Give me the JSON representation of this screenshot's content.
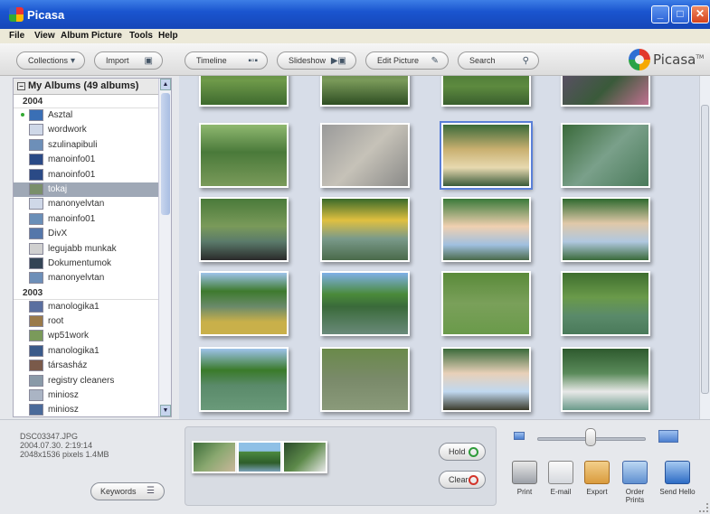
{
  "window": {
    "title": "Picasa"
  },
  "menu": [
    "File",
    "View",
    "Album",
    "Picture",
    "Tools",
    "Help"
  ],
  "toolbar": {
    "collections": "Collections",
    "import": "Import",
    "timeline": "Timeline",
    "slideshow": "Slideshow",
    "edit_picture": "Edit Picture",
    "search": "Search",
    "brand": "Picasa",
    "brand_suffix": "TM"
  },
  "albums": {
    "header": "My Albums (49 albums)",
    "groups": [
      {
        "year": "2004",
        "items": [
          "Asztal",
          "wordwork",
          "szulinapibuli",
          "manoinfo01",
          "manoinfo01",
          "tokaj",
          "manonyelvtan",
          "manoinfo01",
          "DivX",
          "legujabb munkak",
          "Dokumentumok",
          "manonyelvtan"
        ]
      },
      {
        "year": "2003",
        "items": [
          "manologika1",
          "root",
          "wp51work",
          "manologika1",
          "társasház",
          "registry cleaners",
          "miniosz",
          "miniosz"
        ]
      }
    ],
    "selected": "tokaj"
  },
  "photo_info": {
    "filename": "DSC03347.JPG",
    "datetime": "2004.07.30. 2:19:14",
    "details": "2048x1536 pixels  1.4MB"
  },
  "buttons": {
    "keywords": "Keywords",
    "hold": "Hold",
    "clear": "Clear"
  },
  "actions": [
    "Print",
    "E-mail",
    "Export",
    "Order Prints",
    "Send Hello"
  ],
  "colors": {
    "titlebar": "#1a55cf",
    "selection": "#9fa8b6",
    "grid_bg": "#d7dde8",
    "hold_green": "#2f9b3a",
    "clear_red": "#d3342a"
  }
}
